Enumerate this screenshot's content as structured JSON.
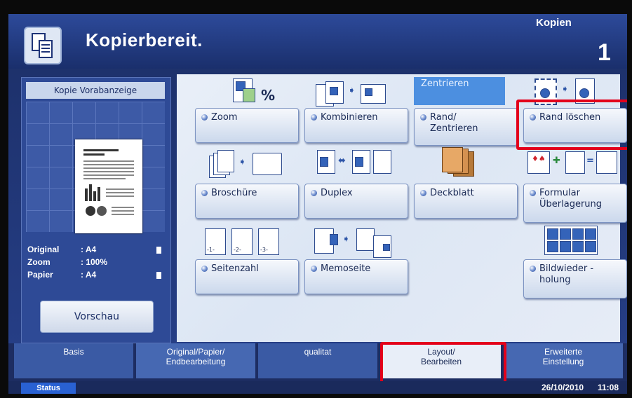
{
  "header": {
    "title": "Kopierbereit.",
    "copies_label": "Kopien",
    "copies_count": "1"
  },
  "preview": {
    "title": "Kopie Vorabanzeige",
    "info": [
      {
        "key": "Original",
        "value": ": A4"
      },
      {
        "key": "Zoom",
        "value": ": 100%"
      },
      {
        "key": "Papier",
        "value": ": A4"
      }
    ],
    "button": "Vorschau"
  },
  "functions": {
    "zoom": "Zoom",
    "zoom_symbol": "%",
    "kombinieren": "Kombinieren",
    "rand_zentrieren": "Rand/\nZentrieren",
    "zentrieren_tag": "Zentrieren",
    "rand_loeschen": "Rand löschen",
    "broschuere": "Broschüre",
    "duplex": "Duplex",
    "deckblatt": "Deckblatt",
    "formular": "Formular\nÜberlagerung",
    "seitenzahl": "Seitenzahl",
    "seitenzahl_icons": [
      "-1-",
      "-2-",
      "-3-"
    ],
    "memoseite": "Memoseite",
    "bildwiederholung": "Bildwieder -\nholung"
  },
  "tabs": [
    {
      "label": "Basis"
    },
    {
      "label": "Original/Papier/\nEndbearbeitung"
    },
    {
      "label": "qualitat"
    },
    {
      "label": "Layout/\nBearbeiten"
    },
    {
      "label": "Erweiterte\nEinstellung"
    }
  ],
  "status": {
    "button": "Status",
    "date": "26/10/2010",
    "time": "11:08"
  },
  "colors": {
    "highlight": "#e3001b",
    "accent": "#2961d3"
  }
}
